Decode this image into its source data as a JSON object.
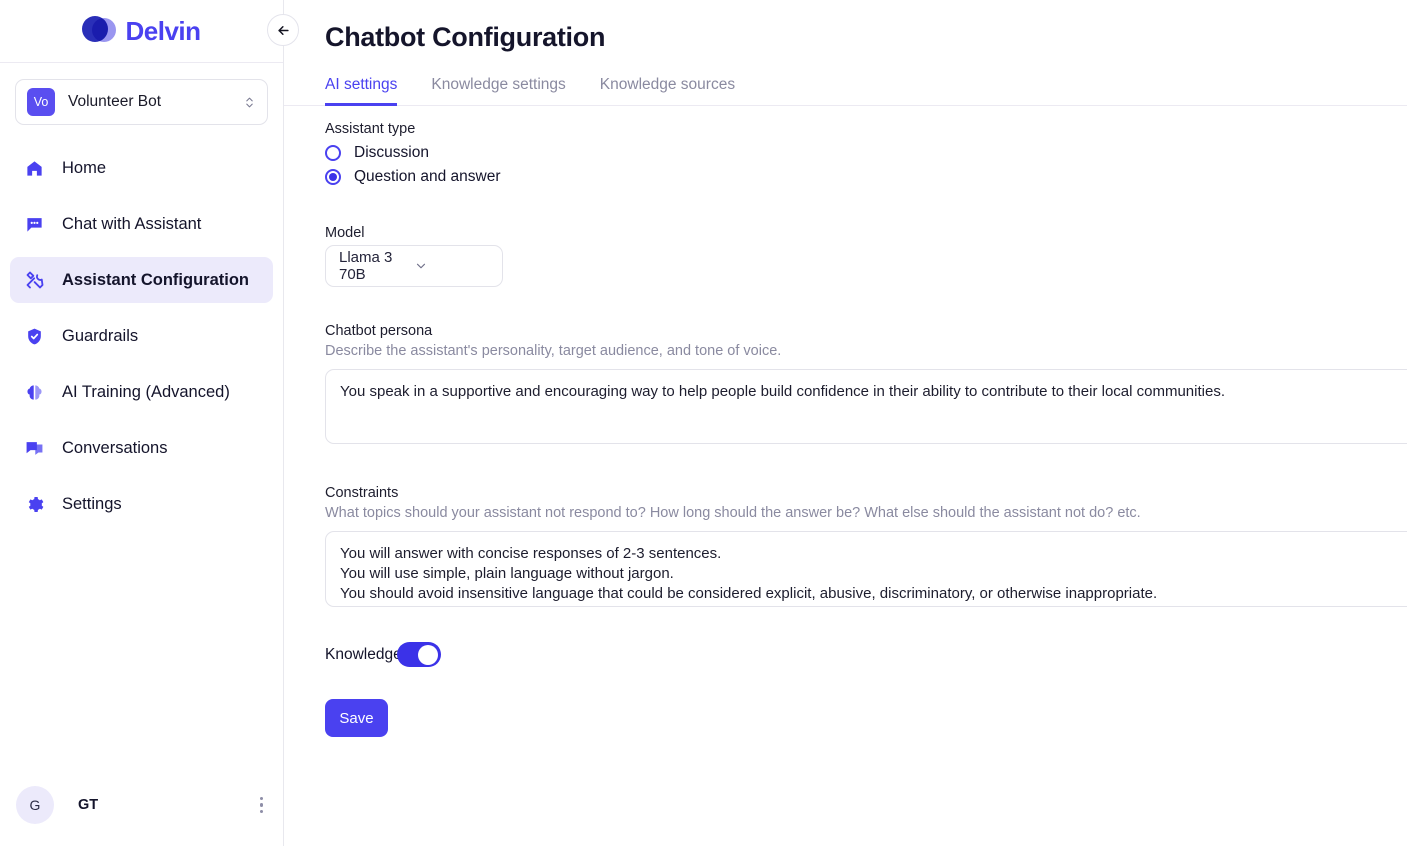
{
  "brand": {
    "name": "Delvin",
    "logo_icon": "delvin-logo-icon",
    "back_icon": "arrow-left-icon"
  },
  "colors": {
    "accent": "#4a41f0",
    "accent_strong": "#3b32e8",
    "active_nav_bg": "#eceafb",
    "title": "#15152b",
    "muted": "#8a8aa0"
  },
  "bot_selector": {
    "avatar_initials": "Vo",
    "name": "Volunteer Bot",
    "chevron_icon": "chevron-up-down-icon"
  },
  "sidebar": {
    "items": [
      {
        "label": "Home",
        "icon": "home-icon",
        "active": false
      },
      {
        "label": "Chat with Assistant",
        "icon": "chat-bubble-icon",
        "active": false
      },
      {
        "label": "Assistant Configuration",
        "icon": "tools-icon",
        "active": true
      },
      {
        "label": "Guardrails",
        "icon": "shield-check-icon",
        "active": false
      },
      {
        "label": "AI Training (Advanced)",
        "icon": "brain-icon",
        "active": false
      },
      {
        "label": "Conversations",
        "icon": "conversations-icon",
        "active": false
      },
      {
        "label": "Settings",
        "icon": "gear-icon",
        "active": false
      }
    ],
    "footer": {
      "avatar_initials": "G",
      "user_label": "GT",
      "menu_icon": "kebab-menu-icon"
    }
  },
  "header": {
    "title": "Chatbot Configuration"
  },
  "tabs": [
    {
      "label": "AI settings",
      "active": true
    },
    {
      "label": "Knowledge settings",
      "active": false
    },
    {
      "label": "Knowledge sources",
      "active": false
    }
  ],
  "assistant_type": {
    "label": "Assistant type",
    "options": [
      {
        "label": "Discussion",
        "selected": false
      },
      {
        "label": "Question and answer",
        "selected": true
      }
    ]
  },
  "model": {
    "label": "Model",
    "value": "Llama 3 70B",
    "chevron_icon": "chevron-down-icon"
  },
  "persona": {
    "label": "Chatbot persona",
    "helper": "Describe the assistant's personality, target audience, and tone of voice.",
    "value": "You speak in a supportive and encouraging way to help people build confidence in their ability to contribute to their local communities."
  },
  "constraints": {
    "label": "Constraints",
    "helper": "What topics should your assistant not respond to? How long should the answer be? What else should the assistant not do? etc.",
    "value": "You will answer with concise responses of 2-3 sentences.\nYou will use simple, plain language without jargon.\nYou should avoid insensitive language that could be considered explicit, abusive, discriminatory, or otherwise inappropriate.\nYou should avoid asking for personal or sensitive information."
  },
  "knowledge": {
    "label": "Knowledge",
    "enabled": true
  },
  "actions": {
    "save_label": "Save"
  }
}
